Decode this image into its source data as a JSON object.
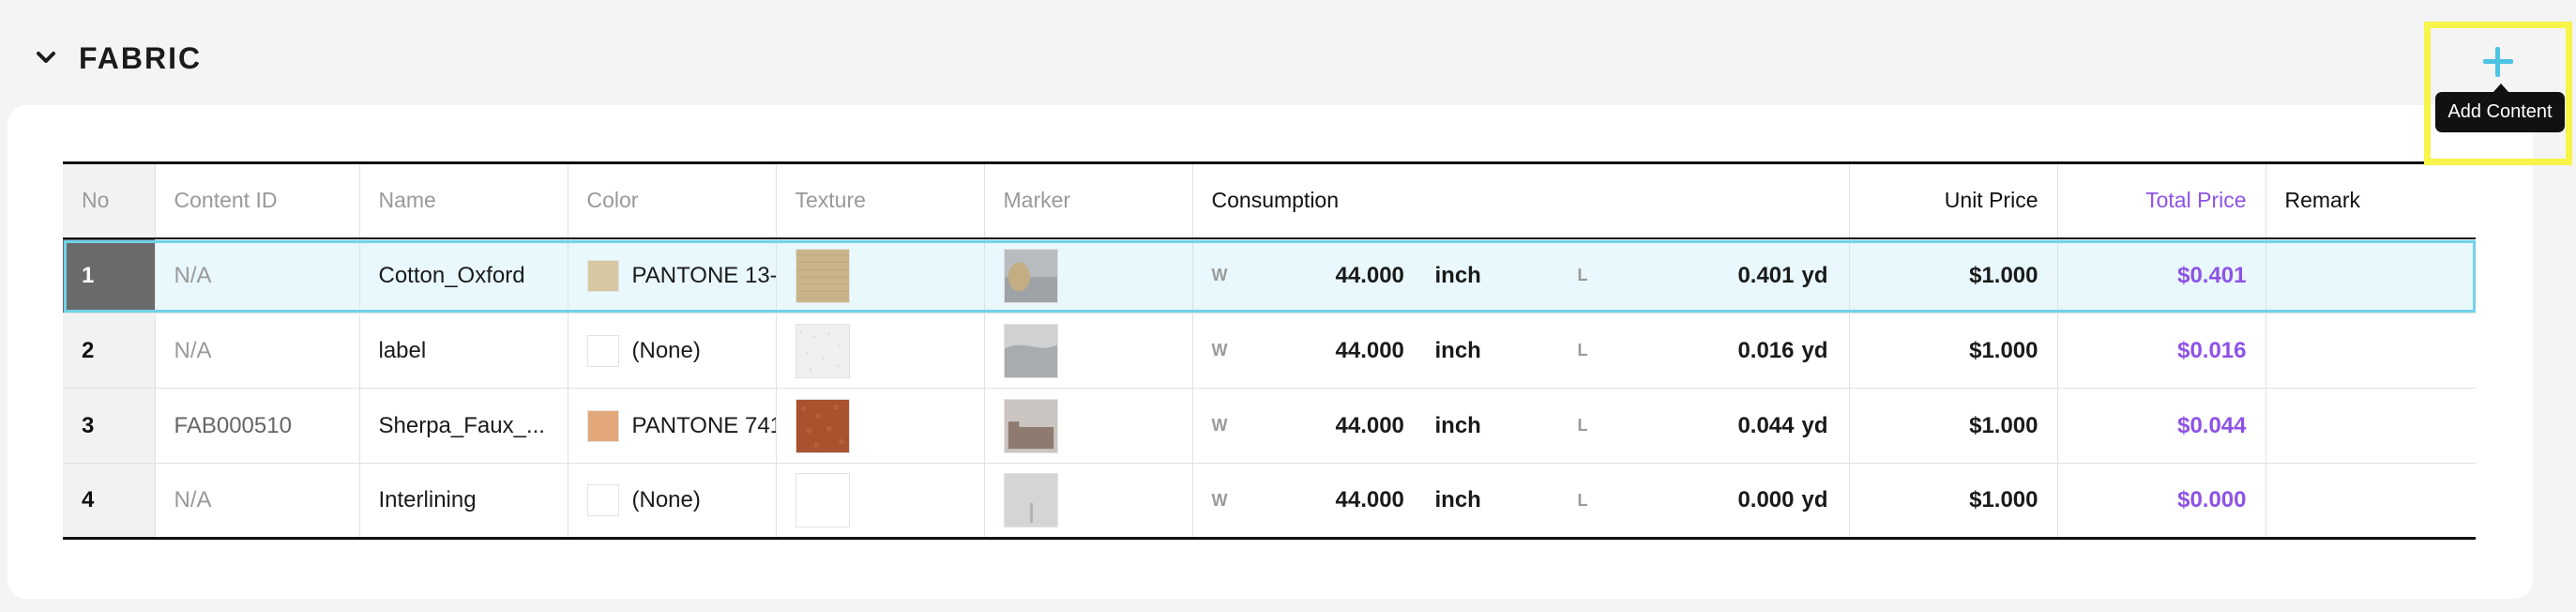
{
  "section": {
    "title": "FABRIC"
  },
  "add_content": {
    "tooltip": "Add Content"
  },
  "columns": {
    "no": "No",
    "content_id": "Content ID",
    "name": "Name",
    "color": "Color",
    "texture": "Texture",
    "marker": "Marker",
    "consumption": "Consumption",
    "unit_price": "Unit Price",
    "total_price": "Total Price",
    "remark": "Remark"
  },
  "rows": [
    {
      "no": "1",
      "content_id": "N/A",
      "name": "Cotton_Oxford",
      "color_name": "PANTONE 13-",
      "swatch": "#d7c7a3",
      "texture": "#c9b589",
      "w_label": "W",
      "width": "44.000",
      "width_unit": "inch",
      "l_label": "L",
      "length": "0.401",
      "length_unit": "yd",
      "unit_price": "$1.000",
      "total_price": "$0.401",
      "remark": ""
    },
    {
      "no": "2",
      "content_id": "N/A",
      "name": "label",
      "color_name": "(None)",
      "swatch": "#ffffff",
      "texture": "#f2f2f2",
      "w_label": "W",
      "width": "44.000",
      "width_unit": "inch",
      "l_label": "L",
      "length": "0.016",
      "length_unit": "yd",
      "unit_price": "$1.000",
      "total_price": "$0.016",
      "remark": ""
    },
    {
      "no": "3",
      "content_id": "FAB000510",
      "name": "Sherpa_Faux_...",
      "color_name": "PANTONE 741",
      "swatch": "#e3a87a",
      "texture": "#a8522e",
      "w_label": "W",
      "width": "44.000",
      "width_unit": "inch",
      "l_label": "L",
      "length": "0.044",
      "length_unit": "yd",
      "unit_price": "$1.000",
      "total_price": "$0.044",
      "remark": ""
    },
    {
      "no": "4",
      "content_id": "N/A",
      "name": "Interlining",
      "color_name": "(None)",
      "swatch": "#ffffff",
      "texture": "#ffffff",
      "w_label": "W",
      "width": "44.000",
      "width_unit": "inch",
      "l_label": "L",
      "length": "0.000",
      "length_unit": "yd",
      "unit_price": "$1.000",
      "total_price": "$0.000",
      "remark": ""
    }
  ],
  "colors": {
    "accent_purple": "#8e52e8",
    "selection": "#72d2e8",
    "plus": "#4cc3e3",
    "highlight": "#f7f44a"
  }
}
